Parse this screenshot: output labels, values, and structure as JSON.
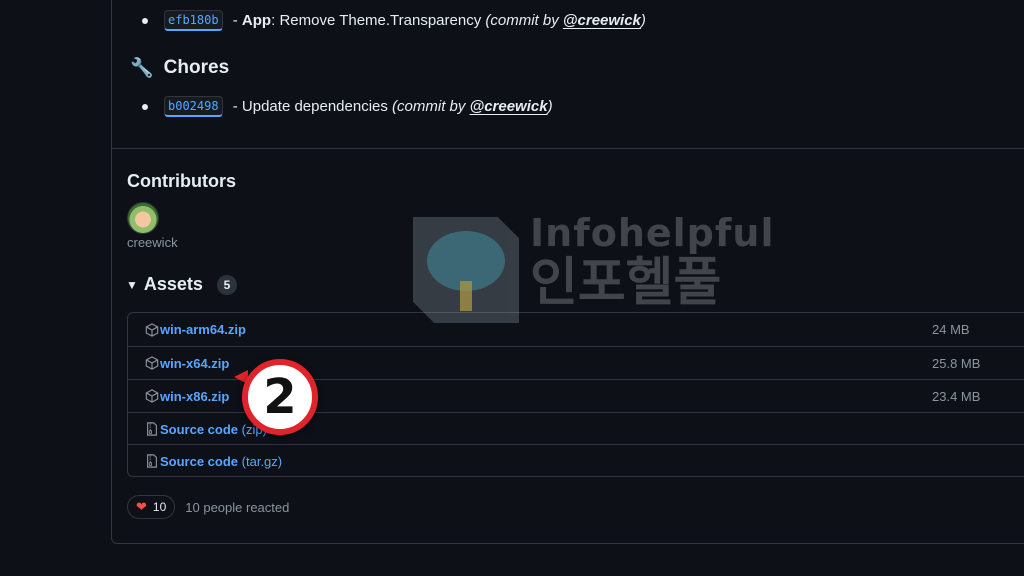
{
  "changelog": {
    "app_item": {
      "sha": "efb180b",
      "scope": "App",
      "message": "Remove Theme.Transparency",
      "commit_by": "(commit by",
      "author": "@creewick",
      "close": ")"
    },
    "chores": {
      "title": "Chores",
      "icon": "wrench-icon",
      "item": {
        "sha": "b002498",
        "message": "- Update dependencies",
        "commit_by": "(commit by",
        "author": "@creewick",
        "close": ")"
      }
    }
  },
  "contributors": {
    "title": "Contributors",
    "avatar_alt": "creewick",
    "name": "creewick"
  },
  "assets": {
    "title": "Assets",
    "count": "5",
    "items": [
      {
        "name": "win-arm64.zip",
        "ext": "",
        "size": "24 MB",
        "icon": "package-icon"
      },
      {
        "name": "win-x64.zip",
        "ext": "",
        "size": "25.8 MB",
        "icon": "package-icon"
      },
      {
        "name": "win-x86.zip",
        "ext": "",
        "size": "23.4 MB",
        "icon": "package-icon"
      },
      {
        "name": "Source code",
        "ext": "(zip)",
        "size": "",
        "icon": "file-zip-icon"
      },
      {
        "name": "Source code",
        "ext": "(tar.gz)",
        "size": "",
        "icon": "file-zip-icon"
      }
    ]
  },
  "reactions": {
    "count": "10",
    "text": "10 people reacted"
  },
  "overlay": {
    "step_number": "2",
    "watermark_en": "Infohelpful",
    "watermark_ko": "인포헬풀"
  },
  "colors": {
    "background": "#0d1117",
    "link": "#58a6ff",
    "border": "#30363d",
    "step_marker": "#e0242b"
  }
}
